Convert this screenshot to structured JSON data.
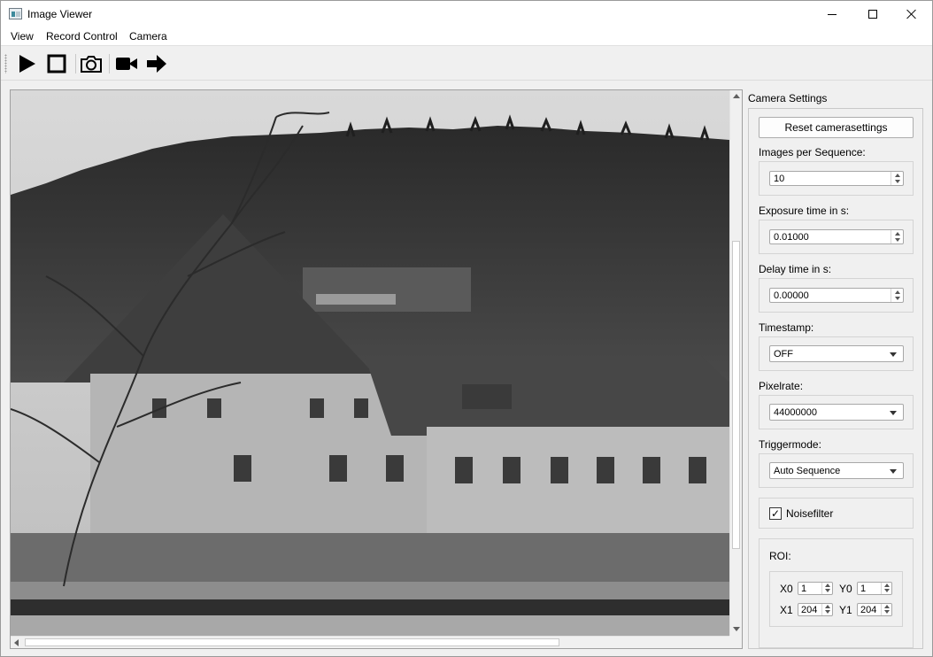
{
  "window": {
    "title": "Image Viewer"
  },
  "menu": [
    "View",
    "Record Control",
    "Camera"
  ],
  "toolbar": {
    "buttons": [
      "play-icon",
      "stop-icon",
      "camera-icon",
      "video-camera-icon",
      "arrow-right-icon"
    ]
  },
  "image": {
    "description_icon": "photo-viewport"
  },
  "settings": {
    "title": "Camera Settings",
    "reset_label": "Reset camerasettings",
    "images_per_sequence": {
      "label": "Images per Sequence:",
      "value": "10"
    },
    "exposure_time": {
      "label": "Exposure time in s:",
      "value": "0.01000"
    },
    "delay_time": {
      "label": "Delay time in s:",
      "value": "0.00000"
    },
    "timestamp": {
      "label": "Timestamp:",
      "value": "OFF"
    },
    "pixelrate": {
      "label": "Pixelrate:",
      "value": "44000000"
    },
    "triggermode": {
      "label": "Triggermode:",
      "value": "Auto Sequence"
    },
    "noisefilter": {
      "label": "Noisefilter",
      "checked": true,
      "mark": "✓"
    },
    "roi": {
      "label": "ROI:",
      "x0": {
        "label": "X0",
        "value": "1"
      },
      "y0": {
        "label": "Y0",
        "value": "1"
      },
      "x1": {
        "label": "X1",
        "value": "204"
      },
      "y1": {
        "label": "Y1",
        "value": "204"
      }
    }
  }
}
